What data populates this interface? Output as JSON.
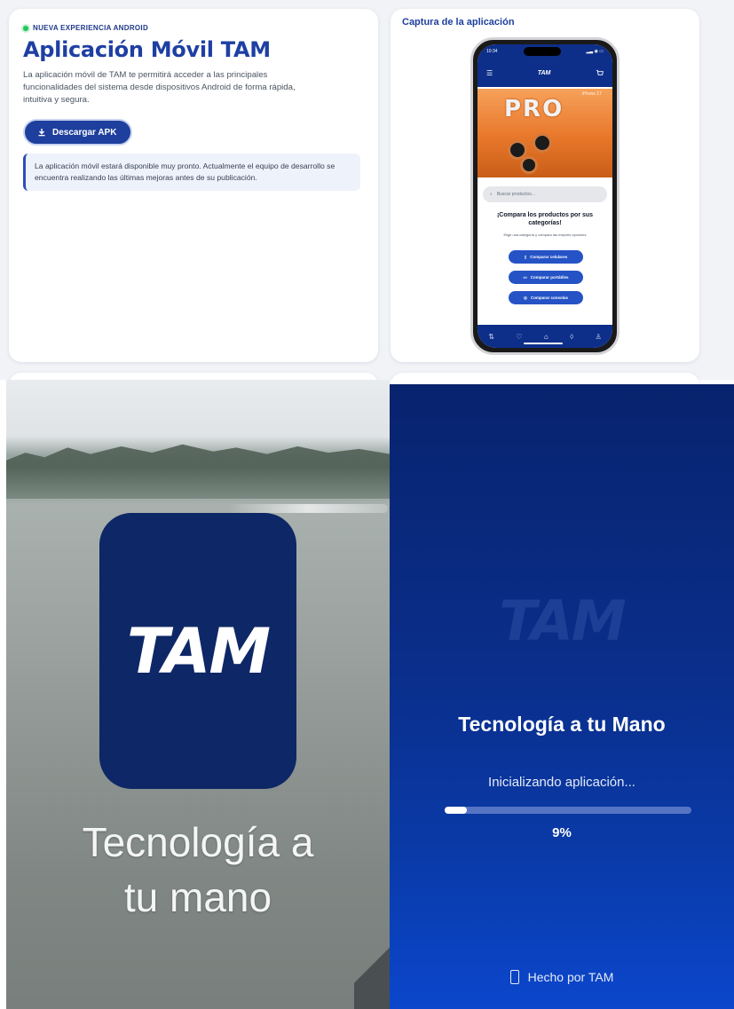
{
  "web": {
    "badge": "NUEVA EXPERIENCIA ANDROID",
    "title": "Aplicación Móvil TAM",
    "description": "La aplicación móvil de TAM te permitirá acceder a las principales funcionalidades del sistema desde dispositivos Android de forma rápida, intuitiva y segura.",
    "download_label": "Descargar APK",
    "notice": "La aplicación móvil estará disponible muy pronto. Actualmente el equipo de desarrollo se encuentra realizando las últimas mejoras antes de su publicación.",
    "screenshot_title": "Captura de la aplicación"
  },
  "phone_screen": {
    "time": "10:34",
    "logo": "TAM",
    "hero_subtitle": "iPhone 17",
    "hero_title": "PRO",
    "search_placeholder": "Buscar productos...",
    "compare_title": "¡Compara los productos por sus categorías!",
    "compare_subtitle": "Elige una categoría y compara las mejores opciones",
    "buttons": [
      "Comparar celulares",
      "Comparar portátiles",
      "Comparar consolas"
    ]
  },
  "icon_photo": {
    "logo_text": "TAM",
    "caption_line1": "Tecnología a",
    "caption_line2": "tu mano"
  },
  "splash": {
    "logo_text": "TAM",
    "title": "Tecnología a tu Mano",
    "status": "Inicializando aplicación...",
    "progress_percent": 9,
    "percent_label": "9%",
    "footer": "Hecho por TAM"
  },
  "colors": {
    "brand_blue": "#1e3fa3",
    "splash_blue": "#0a2e8a",
    "accent_green": "#22c55e",
    "hero_orange": "#e8772a"
  },
  "icons": [
    "download-icon",
    "menu-icon",
    "cart-icon",
    "search-icon",
    "phone-icon",
    "laptop-icon",
    "gamepad-icon",
    "compare-icon",
    "heart-icon",
    "home-icon",
    "bell-icon",
    "user-icon"
  ]
}
